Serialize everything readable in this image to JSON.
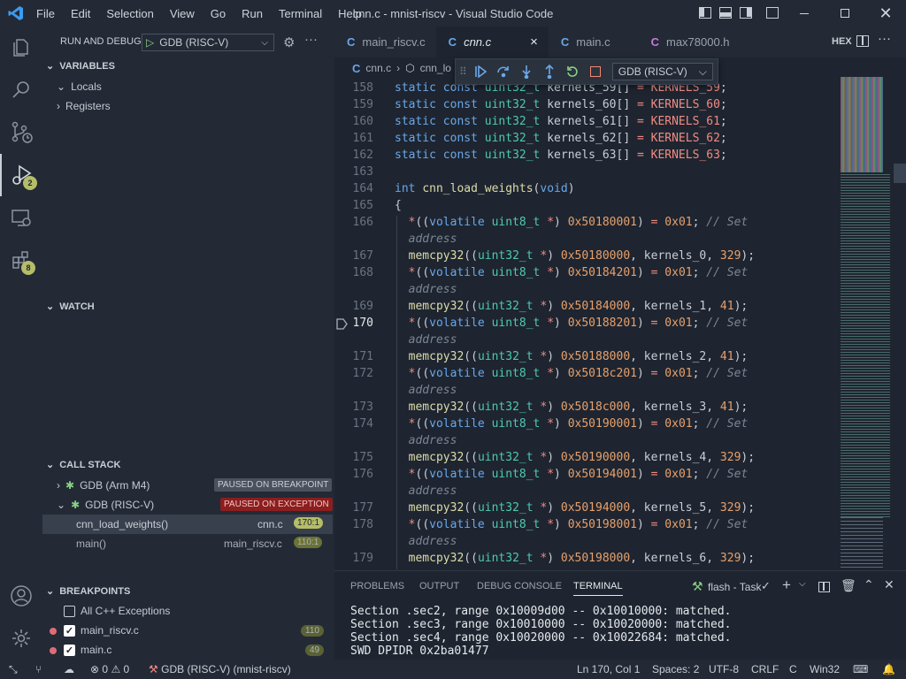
{
  "window": {
    "title": "cnn.c - mnist-riscv - Visual Studio Code"
  },
  "menu": [
    "File",
    "Edit",
    "Selection",
    "View",
    "Go",
    "Run",
    "Terminal",
    "Help"
  ],
  "activity": {
    "debug_badge": "2",
    "extensions_badge": "8"
  },
  "sidebar": {
    "header": "RUN AND DEBUG",
    "config": "GDB (RISC-V)",
    "variables": {
      "title": "VARIABLES",
      "items": [
        "Locals",
        "Registers"
      ]
    },
    "watch": {
      "title": "WATCH"
    },
    "callstack": {
      "title": "CALL STACK",
      "sessions": [
        {
          "name": "GDB (Arm M4)",
          "status": "PAUSED ON BREAKPOINT"
        },
        {
          "name": "GDB (RISC-V)",
          "status": "PAUSED ON EXCEPTION"
        }
      ],
      "frames": [
        {
          "fn": "cnn_load_weights()",
          "file": "cnn.c",
          "pos": "170:1"
        },
        {
          "fn": "main()",
          "file": "main_riscv.c",
          "pos": "110:1"
        }
      ]
    },
    "breakpoints": {
      "title": "BREAKPOINTS",
      "items": [
        {
          "label": "All C++ Exceptions",
          "checked": false,
          "count": ""
        },
        {
          "label": "main_riscv.c",
          "checked": true,
          "count": "110"
        },
        {
          "label": "main.c",
          "checked": true,
          "count": "49"
        }
      ]
    }
  },
  "tabs": [
    {
      "label": "main_riscv.c"
    },
    {
      "label": "cnn.c"
    },
    {
      "label": "main.c"
    },
    {
      "label": "max78000.h"
    }
  ],
  "tab_close": "×",
  "editor_actions": {
    "hex": "HEX"
  },
  "breadcrumb": {
    "file": "cnn.c",
    "symbol": "cnn_lo"
  },
  "debug_toolbar": {
    "config": "GDB (RISC-V)"
  },
  "code": {
    "current_line": "170",
    "lines": [
      {
        "n": "158",
        "t": "static const uint32_t kernels_59[] = KERNELS_59;"
      },
      {
        "n": "159",
        "t": "static const uint32_t kernels_60[] = KERNELS_60;"
      },
      {
        "n": "160",
        "t": "static const uint32_t kernels_61[] = KERNELS_61;"
      },
      {
        "n": "161",
        "t": "static const uint32_t kernels_62[] = KERNELS_62;"
      },
      {
        "n": "162",
        "t": "static const uint32_t kernels_63[] = KERNELS_63;"
      },
      {
        "n": "163",
        "t": ""
      },
      {
        "n": "164",
        "t": "int cnn_load_weights(void)"
      },
      {
        "n": "165",
        "t": "{"
      },
      {
        "n": "166",
        "t": "  *((volatile uint8_t *) 0x50180001) = 0x01; // Set"
      },
      {
        "n": "",
        "t": "  address"
      },
      {
        "n": "167",
        "t": "  memcpy32((uint32_t *) 0x50180000, kernels_0, 329);"
      },
      {
        "n": "168",
        "t": "  *((volatile uint8_t *) 0x50184201) = 0x01; // Set"
      },
      {
        "n": "",
        "t": "  address"
      },
      {
        "n": "169",
        "t": "  memcpy32((uint32_t *) 0x50184000, kernels_1, 41);"
      },
      {
        "n": "170",
        "t": "  *((volatile uint8_t *) 0x50188201) = 0x01; // Set"
      },
      {
        "n": "",
        "t": "  address"
      },
      {
        "n": "171",
        "t": "  memcpy32((uint32_t *) 0x50188000, kernels_2, 41);"
      },
      {
        "n": "172",
        "t": "  *((volatile uint8_t *) 0x5018c201) = 0x01; // Set"
      },
      {
        "n": "",
        "t": "  address"
      },
      {
        "n": "173",
        "t": "  memcpy32((uint32_t *) 0x5018c000, kernels_3, 41);"
      },
      {
        "n": "174",
        "t": "  *((volatile uint8_t *) 0x50190001) = 0x01; // Set"
      },
      {
        "n": "",
        "t": "  address"
      },
      {
        "n": "175",
        "t": "  memcpy32((uint32_t *) 0x50190000, kernels_4, 329);"
      },
      {
        "n": "176",
        "t": "  *((volatile uint8_t *) 0x50194001) = 0x01; // Set"
      },
      {
        "n": "",
        "t": "  address"
      },
      {
        "n": "177",
        "t": "  memcpy32((uint32_t *) 0x50194000, kernels_5, 329);"
      },
      {
        "n": "178",
        "t": "  *((volatile uint8_t *) 0x50198001) = 0x01; // Set"
      },
      {
        "n": "",
        "t": "  address"
      },
      {
        "n": "179",
        "t": "  memcpy32((uint32_t *) 0x50198000, kernels_6, 329);"
      }
    ]
  },
  "panel": {
    "tabs": [
      "PROBLEMS",
      "OUTPUT",
      "DEBUG CONSOLE",
      "TERMINAL"
    ],
    "active_tab": "TERMINAL",
    "task": "flash - Task",
    "lines": [
      "Section .sec2, range 0x10009d00 -- 0x10010000: matched.",
      "Section .sec3, range 0x10010000 -- 0x10020000: matched.",
      "Section .sec4, range 0x10020000 -- 0x10022684: matched.",
      "SWD DPIDR 0x2ba01477"
    ]
  },
  "status": {
    "errors": "0",
    "warnings": "0",
    "debug": "GDB (RISC-V) (mnist-riscv)",
    "position": "Ln 170, Col 1",
    "spaces": "Spaces: 2",
    "encoding": "UTF-8",
    "eol": "CRLF",
    "language": "C",
    "platform": "Win32"
  }
}
